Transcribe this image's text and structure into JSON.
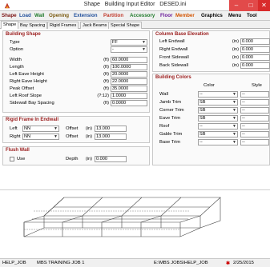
{
  "window": {
    "title": "Shape   Building Input Editor   DESED.ini",
    "minimize_glyph": "–",
    "maximize_glyph": "□",
    "close_glyph": "✕"
  },
  "menubar": {
    "items": [
      {
        "label": "Shape",
        "color": "#7a1010"
      },
      {
        "label": "Load",
        "color": "#1f4e9a"
      },
      {
        "label": "Wall",
        "color": "#1f7a2a"
      },
      {
        "label": "Opening",
        "color": "#7a5a10"
      },
      {
        "label": "Extension",
        "color": "#1f4e9a"
      },
      {
        "label": "Partition",
        "color": "#c0392b"
      },
      {
        "label": "Accessory",
        "color": "#1f7a2a"
      },
      {
        "label": "Floor",
        "color": "#6a1b9a"
      },
      {
        "label": "Member",
        "color": "#d35400"
      },
      {
        "label": "Graphics",
        "color": "#000000"
      },
      {
        "label": "Menu",
        "color": "#000000"
      },
      {
        "label": "Tool",
        "color": "#000000"
      }
    ]
  },
  "tabs": [
    {
      "label": "Shape",
      "active": true
    },
    {
      "label": "Bay Spacing",
      "active": false
    },
    {
      "label": "Rigid Frames",
      "active": false
    },
    {
      "label": "Jack Beams",
      "active": false
    },
    {
      "label": "Special Shape",
      "active": false
    }
  ],
  "building_shape": {
    "title": "Building Shape",
    "type_label": "Type",
    "type_value": "FF",
    "option_label": "Option",
    "option_value": "-",
    "width_label": "Width",
    "width_unit": "(ft)",
    "width_value": "60.0000",
    "length_label": "Length",
    "length_unit": "(ft)",
    "length_value": "100.0000",
    "left_eave_label": "Left Eave Height",
    "left_eave_unit": "(ft)",
    "left_eave_value": "20.0000",
    "right_eave_label": "Right Eave Height",
    "right_eave_unit": "(ft)",
    "right_eave_value": "22.0000",
    "peak_offset_label": "Peak Offset",
    "peak_offset_unit": "(ft)",
    "peak_offset_value": "35.0000",
    "left_roof_slope_label": "Left Roof Slope",
    "left_roof_slope_unit": "(?:12)",
    "left_roof_slope_value": "1.0000",
    "sidewall_bay_label": "Sidewall Bay Spacing",
    "sidewall_bay_unit": "(ft)",
    "sidewall_bay_value": "0.0000"
  },
  "rigid_frame_endwall": {
    "title": "Rigid Frame In Endwall",
    "left_label": "Left",
    "left_value": "NN",
    "left_offset_label": "Offset",
    "left_offset_unit": "(in)",
    "left_offset_value": "13.000",
    "right_label": "Right",
    "right_value": "NN",
    "right_offset_label": "Offset",
    "right_offset_unit": "(in)",
    "right_offset_value": "13.000"
  },
  "flush_wall": {
    "title": "Flush Wall",
    "use_label": "Use",
    "depth_label": "Depth",
    "depth_unit": "(in)",
    "depth_value": "0.000"
  },
  "column_base": {
    "title": "Column Base Elevation",
    "rows": [
      {
        "label": "Left Endwall",
        "unit": "(in)",
        "value": "0.000"
      },
      {
        "label": "Right Endwall",
        "unit": "(in)",
        "value": "0.000"
      },
      {
        "label": "Front Sidewall",
        "unit": "(in)",
        "value": "0.000"
      },
      {
        "label": "Back Sidewall",
        "unit": "(in)",
        "value": "0.000"
      }
    ]
  },
  "building_colors": {
    "title": "Building Colors",
    "color_header": "Color",
    "style_header": "Style",
    "rows": [
      {
        "label": "Wall",
        "color": "--",
        "style": "--"
      },
      {
        "label": "Jamb Trim",
        "color": "SB",
        "style": "--"
      },
      {
        "label": "Corner Trim",
        "color": "SB",
        "style": "--"
      },
      {
        "label": "Eave Trim",
        "color": "SB",
        "style": "--"
      },
      {
        "label": "Roof",
        "color": "--",
        "style": "--"
      },
      {
        "label": "Gable Trim",
        "color": "SB",
        "style": "--"
      },
      {
        "label": "Base Trim",
        "color": "--",
        "style": "--"
      }
    ]
  },
  "statusbar": {
    "job": "HELP_JOB",
    "job_name": "MBS TRAINING JOB 1",
    "path": "E:\\MBS JOBS\\HELP_JOB",
    "date": "2/25/2015"
  },
  "colors": {
    "group_title": "#9a1b1b",
    "frame_line": "#444444"
  }
}
